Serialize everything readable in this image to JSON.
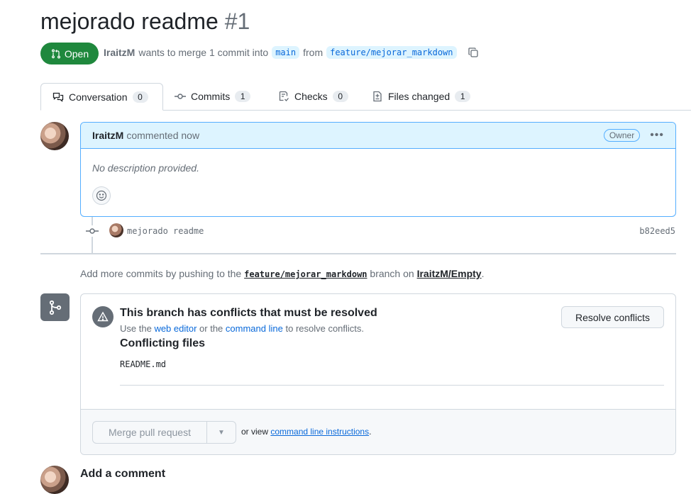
{
  "pr": {
    "title": "mejorado readme",
    "number": "#1",
    "status": "Open",
    "author": "IraitzM",
    "merge_text": "wants to merge 1 commit into",
    "base_branch": "main",
    "from_text": "from",
    "head_branch": "feature/mejorar_markdown"
  },
  "tabs": [
    {
      "label": "Conversation",
      "count": "0",
      "icon": "comment-discussion-icon"
    },
    {
      "label": "Commits",
      "count": "1",
      "icon": "git-commit-icon"
    },
    {
      "label": "Checks",
      "count": "0",
      "icon": "checklist-icon"
    },
    {
      "label": "Files changed",
      "count": "1",
      "icon": "file-diff-icon"
    }
  ],
  "comment": {
    "author": "IraitzM",
    "time": "commented now",
    "role_badge": "Owner",
    "body": "No description provided."
  },
  "commit": {
    "message": "mejorado readme",
    "sha": "b82eed5"
  },
  "push_note": {
    "prefix": "Add more commits by pushing to the",
    "branch": "feature/mejorar_markdown",
    "middle": "branch on",
    "repo": "IraitzM/Empty",
    "suffix": "."
  },
  "merge": {
    "conflict_title": "This branch has conflicts that must be resolved",
    "use_the": "Use the",
    "web_editor": "web editor",
    "or_the": "or the",
    "command_line": "command line",
    "to_resolve": "to resolve conflicts.",
    "conflicting_files_title": "Conflicting files",
    "files": [
      "README.md"
    ],
    "resolve_button": "Resolve conflicts",
    "merge_button": "Merge pull request",
    "or_view": "or view",
    "cli_link": "command line instructions",
    "period": "."
  },
  "add_comment": {
    "title": "Add a comment"
  },
  "colors": {
    "open_green": "#1f883d",
    "link_blue": "#0969da",
    "header_blue": "#ddf4ff"
  }
}
